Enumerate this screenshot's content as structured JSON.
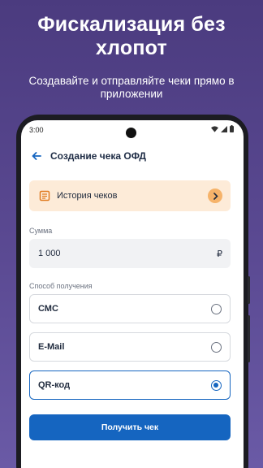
{
  "promo": {
    "title": "Фискализация без хлопот",
    "subtitle": "Создавайте и отправляйте чеки прямо в приложении"
  },
  "status_bar": {
    "time": "3:00"
  },
  "app_bar": {
    "back_icon": "arrow-left-icon",
    "title": "Создание чека ОФД"
  },
  "history": {
    "icon": "receipt-icon",
    "label": "История чеков",
    "chevron_icon": "chevron-right-icon"
  },
  "amount": {
    "label": "Сумма",
    "value": "1 000",
    "currency": "₽"
  },
  "delivery": {
    "label": "Способ получения",
    "options": [
      {
        "label": "СМС",
        "selected": false
      },
      {
        "label": "E-Mail",
        "selected": false
      },
      {
        "label": "QR-код",
        "selected": true
      }
    ]
  },
  "submit": {
    "label": "Получить чек"
  },
  "colors": {
    "accent": "#1565c0",
    "history_bg": "#fdebd8",
    "history_chevron": "#f6b36a",
    "background_top": "#4b3b7f"
  }
}
